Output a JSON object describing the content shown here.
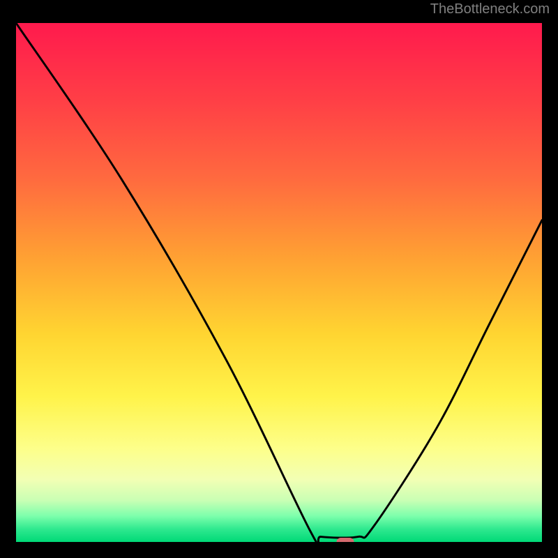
{
  "watermark": "TheBottleneck.com",
  "chart_data": {
    "type": "line",
    "title": "",
    "xlabel": "",
    "ylabel": "",
    "xlim": [
      0,
      100
    ],
    "ylim": [
      0,
      100
    ],
    "marker": {
      "x": 62,
      "y": 1,
      "color": "#d56a6f"
    },
    "curve_points": [
      {
        "x": 0,
        "y": 100
      },
      {
        "x": 20,
        "y": 70
      },
      {
        "x": 40,
        "y": 35
      },
      {
        "x": 56,
        "y": 2
      },
      {
        "x": 58,
        "y": 1
      },
      {
        "x": 65,
        "y": 1
      },
      {
        "x": 68,
        "y": 3
      },
      {
        "x": 80,
        "y": 22
      },
      {
        "x": 90,
        "y": 42
      },
      {
        "x": 100,
        "y": 62
      }
    ],
    "gradient_stops": [
      {
        "pos": 0.0,
        "color": "#ff1a4d"
      },
      {
        "pos": 0.15,
        "color": "#ff3f46"
      },
      {
        "pos": 0.3,
        "color": "#ff6a3f"
      },
      {
        "pos": 0.45,
        "color": "#ffa033"
      },
      {
        "pos": 0.6,
        "color": "#ffd531"
      },
      {
        "pos": 0.72,
        "color": "#fff34a"
      },
      {
        "pos": 0.82,
        "color": "#fdff8a"
      },
      {
        "pos": 0.88,
        "color": "#f2ffb4"
      },
      {
        "pos": 0.92,
        "color": "#c9ffb4"
      },
      {
        "pos": 0.95,
        "color": "#7dffac"
      },
      {
        "pos": 0.975,
        "color": "#2fe98f"
      },
      {
        "pos": 1.0,
        "color": "#00d977"
      }
    ]
  }
}
